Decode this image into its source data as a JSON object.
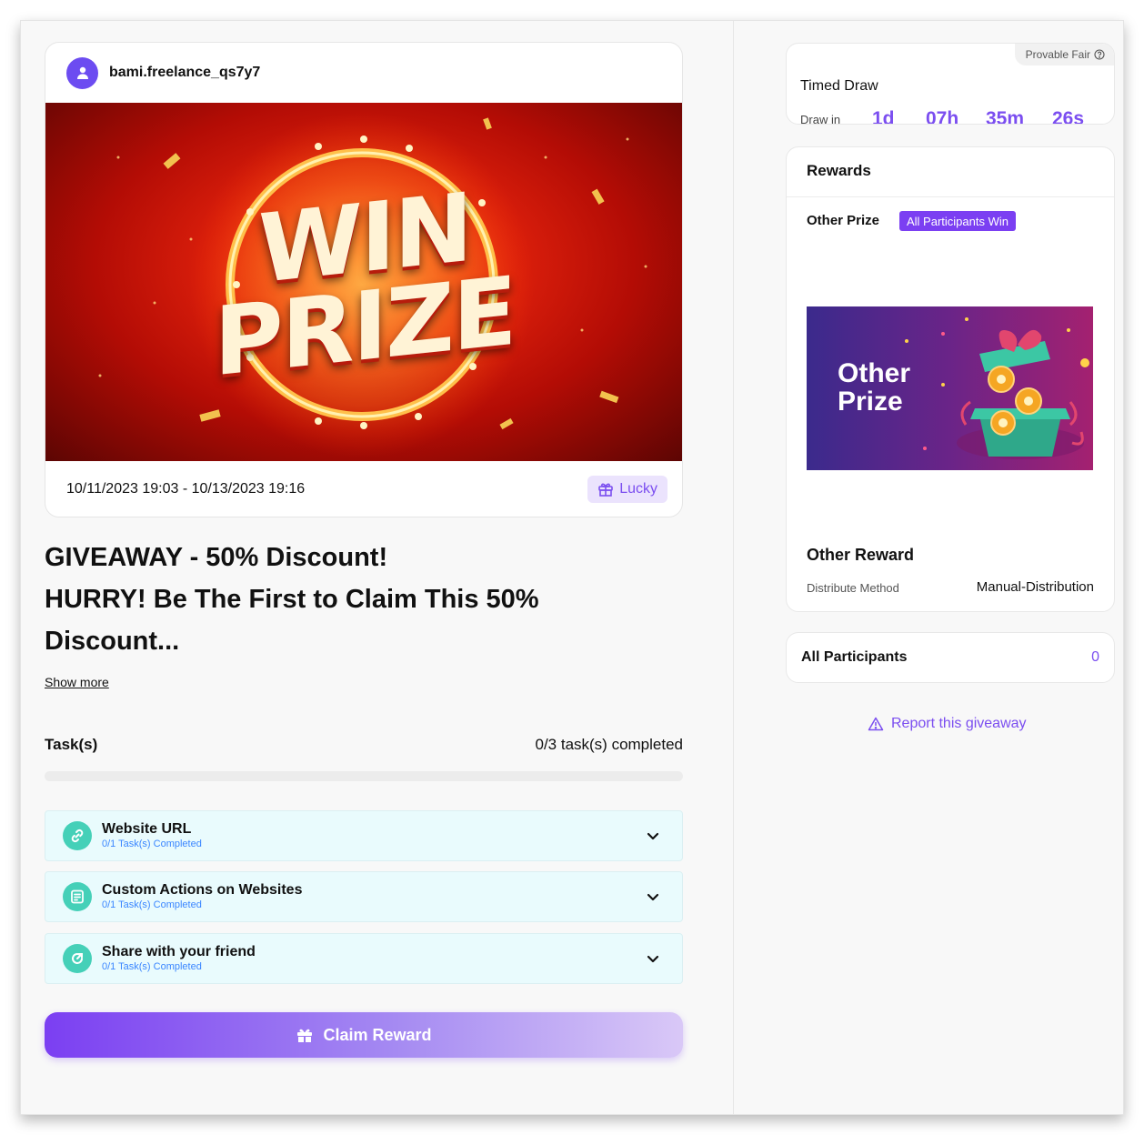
{
  "post": {
    "username": "bami.freelance_qs7y7",
    "banner_word1": "WIN",
    "banner_word2": "PRIZE",
    "date_range": "10/11/2023 19:03 - 10/13/2023 19:16",
    "badge_label": "Lucky"
  },
  "giveaway": {
    "title_lines": [
      "GIVEAWAY - 50% Discount!",
      "HURRY! Be The First to Claim This 50%",
      "Discount..."
    ],
    "show_more": "Show more"
  },
  "tasks": {
    "title": "Task(s)",
    "summary": "0/3 task(s) completed",
    "progress_fraction": 0,
    "items": [
      {
        "title": "Website URL",
        "subtitle": "0/1 Task(s) Completed",
        "icon": "link-icon"
      },
      {
        "title": "Custom Actions on Websites",
        "subtitle": "0/1 Task(s) Completed",
        "icon": "form-icon"
      },
      {
        "title": "Share with your friend",
        "subtitle": "0/1 Task(s) Completed",
        "icon": "share-icon"
      }
    ]
  },
  "claim_button": "Claim Reward",
  "timed_draw": {
    "label": "Timed Draw",
    "provable_fair": "Provable Fair",
    "draw_in": "Draw in",
    "days": "1d",
    "hours": "07h",
    "minutes": "35m",
    "seconds": "26s"
  },
  "rewards": {
    "title": "Rewards",
    "prize_name": "Other Prize",
    "prize_tag": "All Participants Win",
    "image_text": "Other\nPrize",
    "reward_name": "Other Reward",
    "distribute_label": "Distribute Method",
    "distribute_value": "Manual-Distribution"
  },
  "participants": {
    "label": "All Participants",
    "count": "0"
  },
  "report_link": "Report this giveaway",
  "colors": {
    "accent": "#7b4ef0",
    "task_bg": "#e9fbfd",
    "task_icon": "#45d0b8",
    "subtext": "#3a86ff"
  }
}
